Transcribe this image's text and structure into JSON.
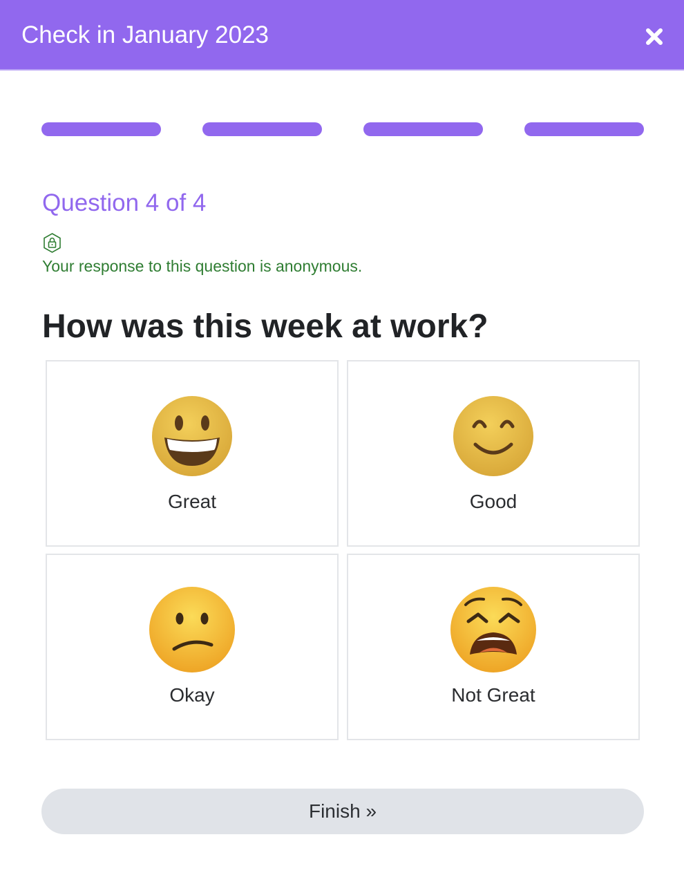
{
  "modal": {
    "title": "Check in January 2023",
    "close_icon": "close-icon",
    "accent_color": "#9168ee"
  },
  "progress": {
    "total_steps": 4,
    "completed_steps": 4,
    "color": "#9168ee"
  },
  "question": {
    "number_label": "Question 4 of 4",
    "anonymous_icon": "lock-icon",
    "anonymous_text": "Your response to this question is anonymous.",
    "anonymous_color": "#2f7d32",
    "title": "How was this week at work?"
  },
  "options": [
    {
      "label": "Great",
      "icon": "grinning-face-icon"
    },
    {
      "label": "Good",
      "icon": "smiling-face-icon"
    },
    {
      "label": "Okay",
      "icon": "confused-face-icon"
    },
    {
      "label": "Not Great",
      "icon": "weary-face-icon"
    }
  ],
  "footer": {
    "finish_label": "Finish »"
  }
}
